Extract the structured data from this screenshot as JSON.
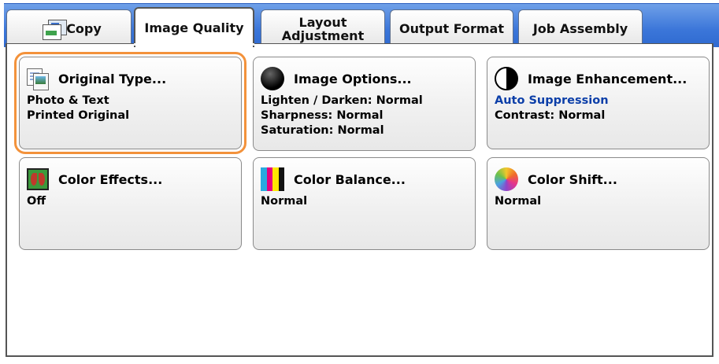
{
  "tabs": [
    {
      "label": "Copy",
      "icon": "copy-icon",
      "active": false
    },
    {
      "label": "Image Quality",
      "active": true
    },
    {
      "label": "Layout\nAdjustment",
      "active": false
    },
    {
      "label": "Output Format",
      "active": false
    },
    {
      "label": "Job Assembly",
      "active": false
    }
  ],
  "cards": {
    "original_type": {
      "title": "Original Type...",
      "icon": "original-type-icon",
      "lines": [
        "Photo & Text",
        "Printed Original"
      ],
      "selected": true
    },
    "image_options": {
      "title": "Image Options...",
      "icon": "black-ball-icon",
      "lines": [
        "Lighten / Darken: Normal",
        "Sharpness: Normal",
        "Saturation: Normal"
      ]
    },
    "image_enhancement": {
      "title": "Image Enhancement...",
      "icon": "contrast-icon",
      "lines": [
        "Auto Suppression",
        "Contrast: Normal"
      ]
    },
    "color_effects": {
      "title": "Color Effects...",
      "icon": "butterfly-icon",
      "lines": [
        "Off"
      ]
    },
    "color_balance": {
      "title": "Color Balance...",
      "icon": "color-bars-icon",
      "lines": [
        "Normal"
      ]
    },
    "color_shift": {
      "title": "Color Shift...",
      "icon": "color-wheel-icon",
      "lines": [
        "Normal"
      ]
    }
  },
  "colors": {
    "tab_bar": "#3b76d9",
    "selection_outline": "#f3923b",
    "highlight_text": "#0b3ea8",
    "color_bars": [
      "#29a9e0",
      "#e5007e",
      "#ffe600",
      "#111111"
    ]
  }
}
